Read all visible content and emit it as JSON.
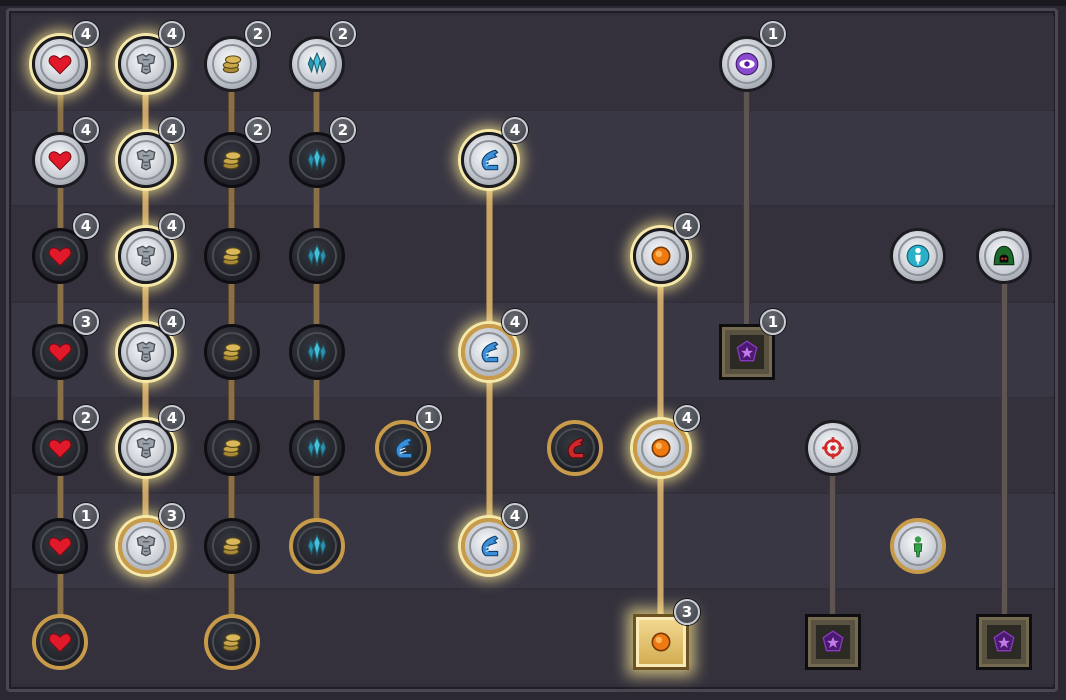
{
  "title": "",
  "colors": {
    "accent_gold": "#c79b49",
    "glow": "#f6e8a8",
    "heart": "#e01a2a",
    "crystal": "#3aa7c4",
    "wing": "#3a8fd8",
    "orb": "#f07a12",
    "eye": "#8a4ad0",
    "target": "#d02a2a",
    "figure": "#35a24a",
    "aqua": "#2ab0c8",
    "star": "#8a3ac0"
  },
  "columns": [
    {
      "id": "heart",
      "icon": "heart-icon"
    },
    {
      "id": "armor",
      "icon": "armor-icon"
    },
    {
      "id": "coins",
      "icon": "coins-icon"
    },
    {
      "id": "crystal",
      "icon": "crystal-icon"
    },
    {
      "id": "wing",
      "icon": "wing-icon"
    },
    {
      "id": "orb",
      "icon": "orb-icon"
    },
    {
      "id": "eye",
      "icon": "eye-icon"
    }
  ],
  "badges": {
    "heart": [
      "4",
      "4",
      "4",
      "3",
      "2",
      "1"
    ],
    "armor": [
      "4",
      "4",
      "4",
      "4",
      "4",
      "3"
    ],
    "coins": [
      "2",
      "2"
    ],
    "crystal": [
      "2",
      "2"
    ],
    "wing_small": "1",
    "wing": [
      "4",
      "4",
      "4"
    ],
    "orb": [
      "4",
      "4",
      "3"
    ],
    "eye": "1",
    "eye_square": "1"
  }
}
